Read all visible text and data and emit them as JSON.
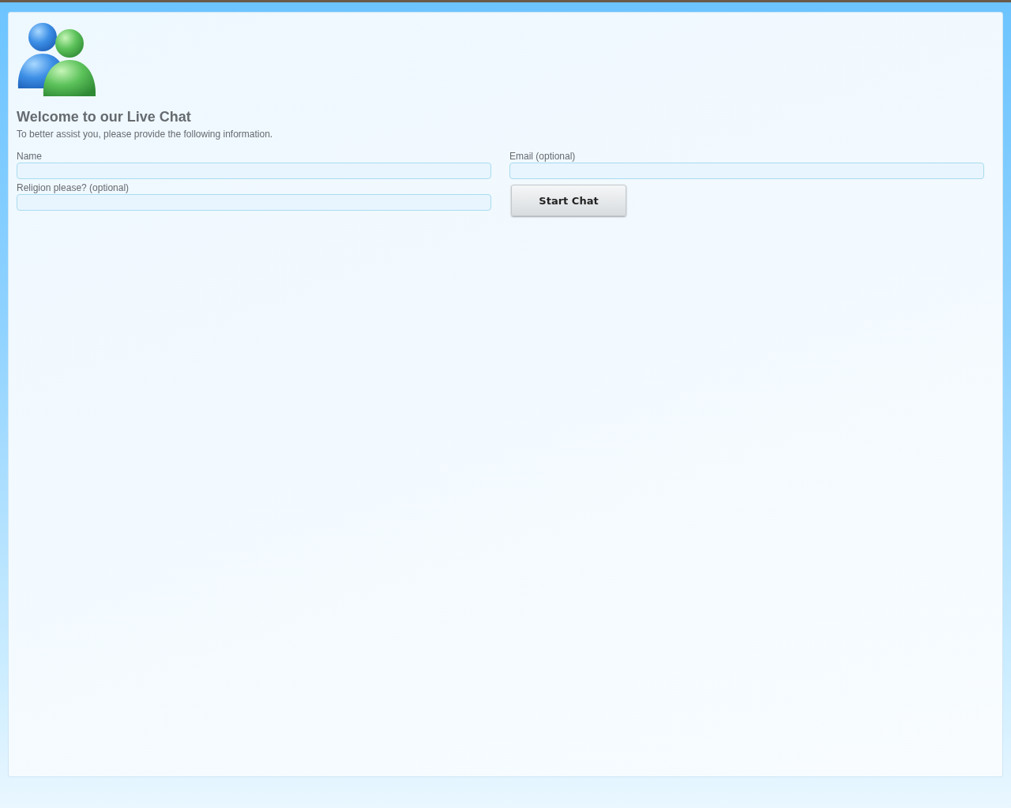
{
  "heading": "Welcome to our Live Chat",
  "subtitle": "To better assist you, please provide the following information.",
  "fields": [
    {
      "label": "Name"
    },
    {
      "label": "Email (optional)"
    },
    {
      "label": "Religion please? (optional)"
    }
  ],
  "button": "Start Chat"
}
